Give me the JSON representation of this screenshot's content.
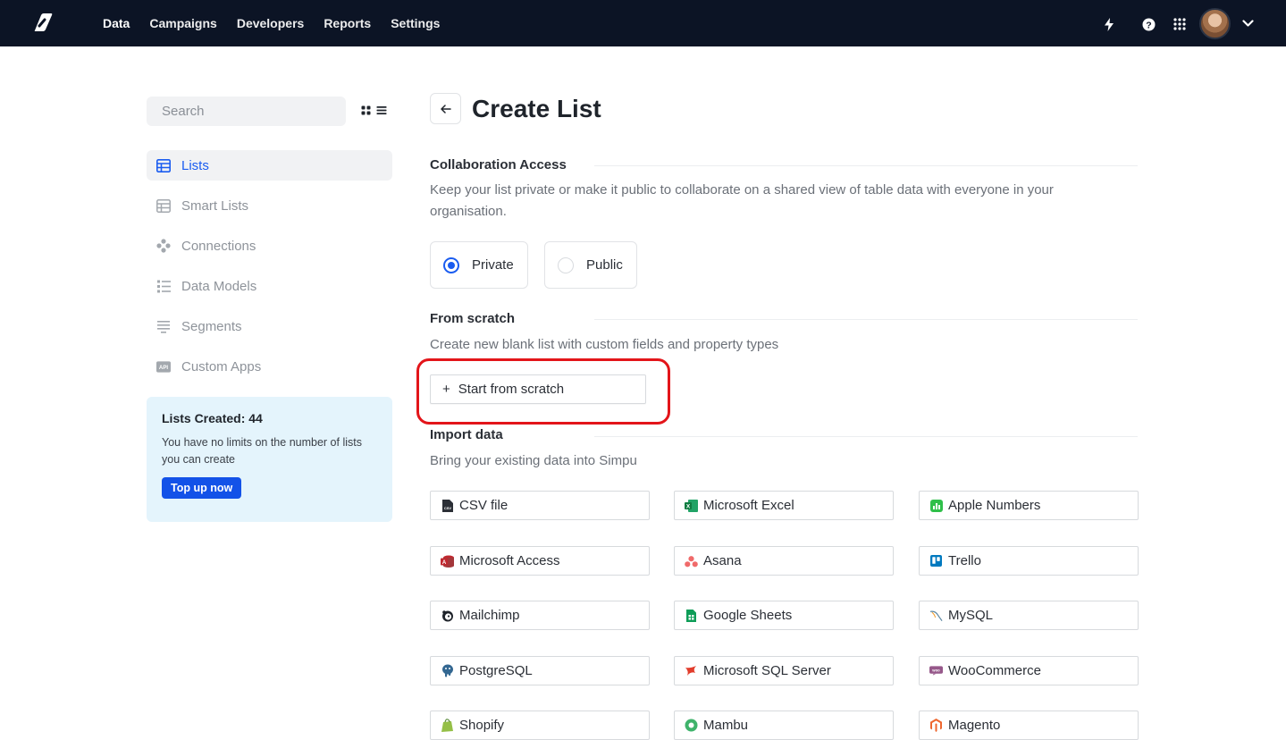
{
  "nav": {
    "links": [
      {
        "label": "Data",
        "active": true
      },
      {
        "label": "Campaigns",
        "active": false
      },
      {
        "label": "Developers",
        "active": false
      },
      {
        "label": "Reports",
        "active": false
      },
      {
        "label": "Settings",
        "active": false
      }
    ],
    "right_icons": [
      "lightning-icon",
      "help-icon",
      "apps-grid-icon",
      "avatar",
      "chevron-down-icon"
    ]
  },
  "sidebar": {
    "search_placeholder": "Search",
    "items": [
      {
        "label": "Lists",
        "icon": "table-icon",
        "active": true
      },
      {
        "label": "Smart Lists",
        "icon": "table-icon",
        "active": false
      },
      {
        "label": "Connections",
        "icon": "connections-icon",
        "active": false
      },
      {
        "label": "Data Models",
        "icon": "data-models-icon",
        "active": false
      },
      {
        "label": "Segments",
        "icon": "segments-icon",
        "active": false
      },
      {
        "label": "Custom Apps",
        "icon": "api-icon",
        "active": false
      }
    ],
    "info_card": {
      "title": "Lists Created: 44",
      "text": "You have no limits on the number of lists you can create",
      "button": "Top up now"
    }
  },
  "main": {
    "title": "Create List",
    "collaboration": {
      "title": "Collaboration Access",
      "description": "Keep your list private or make it public to collaborate on a shared view of table data with everyone in your organisation.",
      "options": [
        {
          "label": "Private",
          "selected": true
        },
        {
          "label": "Public",
          "selected": false
        }
      ]
    },
    "scratch": {
      "title": "From scratch",
      "description": "Create new blank list with custom fields and property types",
      "button": "Start from scratch"
    },
    "import": {
      "title": "Import data",
      "description": "Bring your existing data into Simpu",
      "sources": [
        {
          "label": "CSV file",
          "icon": "csv-file-icon"
        },
        {
          "label": "Microsoft Excel",
          "icon": "excel-icon"
        },
        {
          "label": "Apple Numbers",
          "icon": "numbers-icon"
        },
        {
          "label": "Microsoft Access",
          "icon": "access-icon"
        },
        {
          "label": "Asana",
          "icon": "asana-icon"
        },
        {
          "label": "Trello",
          "icon": "trello-icon"
        },
        {
          "label": "Mailchimp",
          "icon": "mailchimp-icon"
        },
        {
          "label": "Google Sheets",
          "icon": "google-sheets-icon"
        },
        {
          "label": "MySQL",
          "icon": "mysql-icon"
        },
        {
          "label": "PostgreSQL",
          "icon": "postgresql-icon"
        },
        {
          "label": "Microsoft SQL Server",
          "icon": "sql-server-icon"
        },
        {
          "label": "WooCommerce",
          "icon": "woocommerce-icon"
        },
        {
          "label": "Shopify",
          "icon": "shopify-icon"
        },
        {
          "label": "Mambu",
          "icon": "mambu-icon"
        },
        {
          "label": "Magento",
          "icon": "magento-icon"
        }
      ]
    }
  },
  "colors": {
    "nav_bg": "#0c1425",
    "accent": "#1a5cf0",
    "info_bg": "#e4f4fc",
    "highlight": "#e3151a"
  }
}
